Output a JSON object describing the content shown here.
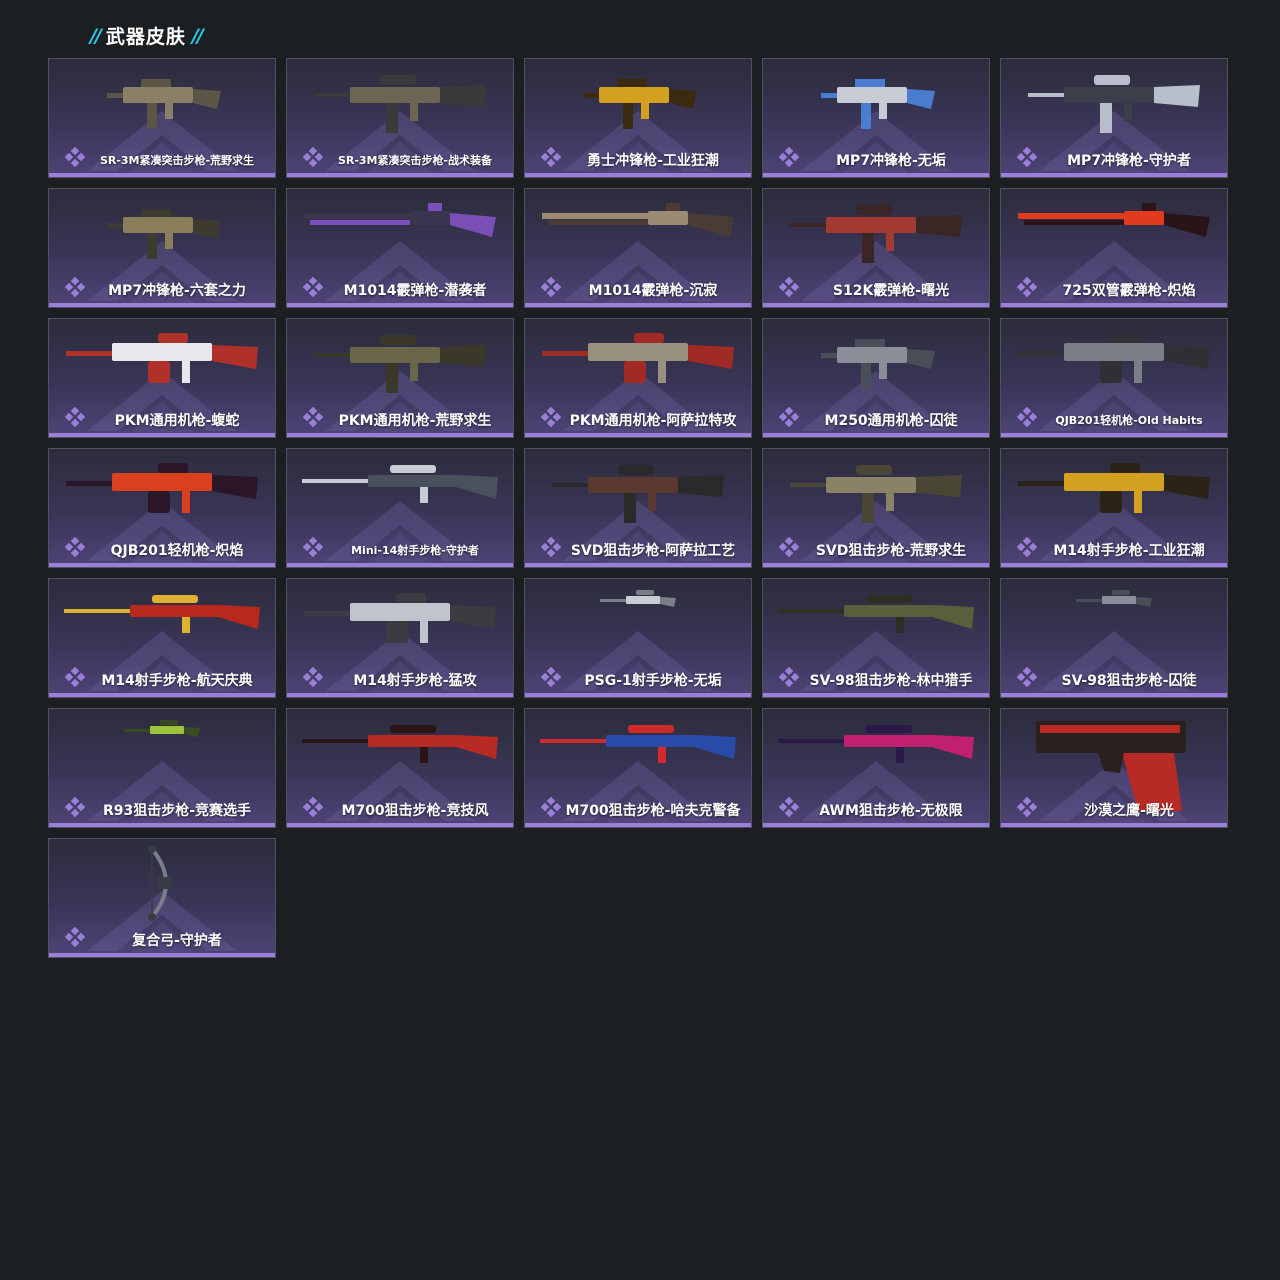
{
  "section": {
    "title": "武器皮肤"
  },
  "colors": {
    "accent": "#27c9e8",
    "rarity": "#9a7fd8",
    "background": "#1c1f22"
  },
  "items": [
    {
      "name": "SR-3M紧凑突击步枪-荒野求生",
      "kind": "smg",
      "palette": [
        "#8a8068",
        "#5c5646"
      ]
    },
    {
      "name": "SR-3M紧凑突击步枪-战术装备",
      "kind": "rifle",
      "palette": [
        "#6d6553",
        "#3a3a3a"
      ]
    },
    {
      "name": "勇士冲锋枪-工业狂潮",
      "kind": "smg",
      "palette": [
        "#d4a020",
        "#3a2a10"
      ]
    },
    {
      "name": "MP7冲锋枪-无垢",
      "kind": "smg",
      "palette": [
        "#c8ccd4",
        "#4a7ccf"
      ]
    },
    {
      "name": "MP7冲锋枪-守护者",
      "kind": "rifle",
      "palette": [
        "#3a3f4a",
        "#b9bfca"
      ]
    },
    {
      "name": "MP7冲锋枪-六套之力",
      "kind": "smg",
      "palette": [
        "#8a7d5a",
        "#3d3a30"
      ]
    },
    {
      "name": "M1014霰弹枪-潜袭者",
      "kind": "shotgun",
      "palette": [
        "#3a3650",
        "#7b4fb8"
      ]
    },
    {
      "name": "M1014霰弹枪-沉寂",
      "kind": "shotgun",
      "palette": [
        "#9c8a72",
        "#4a3c34"
      ]
    },
    {
      "name": "S12K霰弹枪-曙光",
      "kind": "rifle",
      "palette": [
        "#a33a32",
        "#3a2624"
      ]
    },
    {
      "name": "725双管霰弹枪-炽焰",
      "kind": "shotgun",
      "palette": [
        "#e23a1c",
        "#2a1418"
      ]
    },
    {
      "name": "PKM通用机枪-蝮蛇",
      "kind": "mg",
      "palette": [
        "#e8e8ec",
        "#b0302a"
      ]
    },
    {
      "name": "PKM通用机枪-荒野求生",
      "kind": "rifle",
      "palette": [
        "#6a6648",
        "#3a3828"
      ]
    },
    {
      "name": "PKM通用机枪-阿萨拉特攻",
      "kind": "mg",
      "palette": [
        "#9a9080",
        "#a02a24"
      ]
    },
    {
      "name": "M250通用机枪-囚徒",
      "kind": "smg",
      "palette": [
        "#8a8e98",
        "#4a4e58"
      ]
    },
    {
      "name": "QJB201轻机枪-Old Habits",
      "kind": "mg",
      "palette": [
        "#7a7e86",
        "#2e3036"
      ]
    },
    {
      "name": "QJB201轻机枪-炽焰",
      "kind": "mg",
      "palette": [
        "#d8401e",
        "#2a1628"
      ]
    },
    {
      "name": "Mini-14射手步枪-守护者",
      "kind": "sniper",
      "palette": [
        "#4a505c",
        "#c8ccd4"
      ]
    },
    {
      "name": "SVD狙击步枪-阿萨拉工艺",
      "kind": "rifle",
      "palette": [
        "#5a3a30",
        "#2a2a2a"
      ]
    },
    {
      "name": "SVD狙击步枪-荒野求生",
      "kind": "rifle",
      "palette": [
        "#8a8268",
        "#4a4636"
      ]
    },
    {
      "name": "M14射手步枪-工业狂潮",
      "kind": "mg",
      "palette": [
        "#d4a020",
        "#2a2416"
      ]
    },
    {
      "name": "M14射手步枪-航天庆典",
      "kind": "sniper",
      "palette": [
        "#b8281e",
        "#e0b030"
      ]
    },
    {
      "name": "M14射手步枪-猛攻",
      "kind": "mg",
      "palette": [
        "#c0c4cc",
        "#3a3c42"
      ]
    },
    {
      "name": "PSG-1射手步枪-无垢",
      "kind": "tiny",
      "palette": [
        "#c8ccd4",
        "#7a7e88"
      ]
    },
    {
      "name": "SV-98狙击步枪-林中猎手",
      "kind": "sniper",
      "palette": [
        "#5a5e3a",
        "#2e2e22"
      ]
    },
    {
      "name": "SV-98狙击步枪-囚徒",
      "kind": "tiny",
      "palette": [
        "#8a8e98",
        "#4a4e58"
      ]
    },
    {
      "name": "R93狙击步枪-竞赛选手",
      "kind": "tiny",
      "palette": [
        "#9cc43a",
        "#3a4a22"
      ]
    },
    {
      "name": "M700狙击步枪-竞技风",
      "kind": "sniper",
      "palette": [
        "#b82a24",
        "#2a1416"
      ]
    },
    {
      "name": "M700狙击步枪-哈夫克警备",
      "kind": "sniper",
      "palette": [
        "#2a4aa8",
        "#d02a2a"
      ]
    },
    {
      "name": "AWM狙击步枪-无极限",
      "kind": "sniper",
      "palette": [
        "#c0206e",
        "#2a1a4a"
      ]
    },
    {
      "name": "沙漠之鹰-曙光",
      "kind": "pistol",
      "palette": [
        "#b82a24",
        "#2a2020"
      ]
    },
    {
      "name": "复合弓-守护者",
      "kind": "bow",
      "palette": [
        "#7a7e88",
        "#3a3c44"
      ]
    }
  ]
}
